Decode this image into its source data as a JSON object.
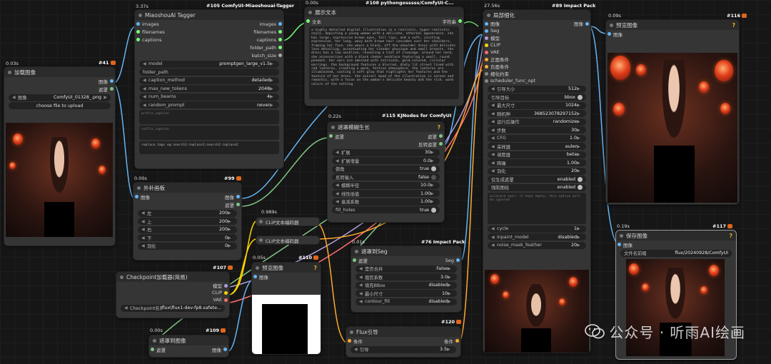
{
  "nodes": {
    "load_image": {
      "time": "0.03s",
      "id": "#41",
      "title": "加载图像",
      "out1": "图像",
      "out2": "遮罩",
      "image_label": "图像",
      "image_value": "ComfyUI_01328_.png",
      "upload": "choose file to upload"
    },
    "tagger": {
      "time": "3.37s",
      "id": "#105 ComfyUI-Miaoshouai-Tagger",
      "title": "MiaoshouAI Tagger",
      "inputs": [
        "images",
        "filenames",
        "captions"
      ],
      "outputs": [
        "images",
        "filenames",
        "captions",
        "folder_path",
        "batch_size"
      ],
      "widgets": [
        {
          "label": "model",
          "value": "promptgen_large_v1.5"
        },
        {
          "label": "folder_path",
          "value": ""
        },
        {
          "label": "caption_method",
          "value": "detailed"
        },
        {
          "label": "max_new_tokens",
          "value": "2048"
        },
        {
          "label": "num_beams",
          "value": "4"
        },
        {
          "label": "random_prompt",
          "value": "never"
        }
      ],
      "prefix": "prefix_caption",
      "suffix": "suffix_caption",
      "replace": "replace_tags eg:search1:replace1;search2:replace2"
    },
    "show_text": {
      "time": "0.00s",
      "id": "#108 pythongosssss/ComfyUI-C...",
      "title": "展示文本",
      "in": "文本",
      "out": "字符串",
      "text": "a highly detailed digital illustration in a realistic, hyper-realistic style, depicting a young woman with a delicate, ethereal appearance. she has large, expressive brown eyes, full lips, and a soft, inviting expression. her long, wavy dark brown hair cascades over her shoulders, framing her face. she wears a black, off-the-shoulder dress with delicate lace detailing, accentuating her slender physique and small breasts. the dress has a low neckline, revealing a hint of cleavage. around her neck, she accessorizes with a black choker necklace featuring a small, round pendant. her ears are adorned with intricate, gold-colored, circular earrings. the background features a blurred, dimly lit street lined with red lanterns, creating a warm, festive atmosphere. the lanterns are illuminated, casting a soft glow that highlights her features and the texture of her dress. the overall mood of the illustration is serene and romantic, with a focus on the woman's delicate beauty and the rich, warm colors of the setting"
    },
    "outpaint": {
      "time": "0.00s",
      "id": "#99",
      "title": "外补画板",
      "in": "图像",
      "out1": "图像",
      "out2": "遮罩",
      "widgets": [
        {
          "label": "左",
          "value": "200"
        },
        {
          "label": "上",
          "value": "200"
        },
        {
          "label": "右",
          "value": "200"
        },
        {
          "label": "下",
          "value": "0"
        },
        {
          "label": "羽化",
          "value": "0"
        }
      ]
    },
    "grow_mask": {
      "time": "0.22s",
      "id": "#115 KJNodes for ComfyUI",
      "title": "遮罩模糊生长",
      "in": "遮罩",
      "out1": "遮罩",
      "out2": "反转遮罩",
      "widgets": [
        {
          "label": "扩展",
          "value": "30"
        },
        {
          "label": "扩展增量",
          "value": "0.0"
        },
        {
          "label": "倒角",
          "value": "true",
          "toggle": true
        },
        {
          "label": "反转输入",
          "value": "false"
        },
        {
          "label": "模糊半径",
          "value": "10.0"
        },
        {
          "label": "线性插值",
          "value": "1.00"
        },
        {
          "label": "衰减系数",
          "value": "1.00"
        },
        {
          "label": "fill_holes",
          "value": "true",
          "toggle": true
        }
      ]
    },
    "clip_enc1": {
      "time": "0.989s",
      "title": "CLIP文本编码器"
    },
    "clip_enc2": {
      "title": "CLIP文本编码器"
    },
    "mask_to_seg": {
      "time": "0.01s",
      "id": "#76 Impact Pack",
      "title": "遮罩到Seg",
      "in": "遮罩",
      "out": "Seg",
      "widgets": [
        {
          "label": "是否合并",
          "value": "False"
        },
        {
          "label": "裁剪系数",
          "value": "3.0"
        },
        {
          "label": "填充BBox",
          "value": "disabled"
        },
        {
          "label": "最小尺寸",
          "value": "10"
        },
        {
          "label": "contour_fill",
          "value": "disabled"
        }
      ]
    },
    "checkpoint": {
      "id": "#107",
      "title": "Checkpoint加载器(简易)",
      "outputs": [
        "模型",
        "CLIP",
        "VAE"
      ],
      "ckpt_label": "Checkpoint名称",
      "ckpt_value": "flux\\flux1-dev-fp8.safete..."
    },
    "preview_mask": {
      "time": "0.05s",
      "id": "#110",
      "title": "预览图像",
      "in": "图像"
    },
    "mask_to_image": {
      "time": "0.00s",
      "id": "#109",
      "title": "遮罩到图像",
      "in": "遮罩",
      "out": "图像"
    },
    "flux_guide": {
      "id": "#120",
      "title": "Flux引导",
      "in": "条件",
      "out": "条件",
      "label": "引导",
      "value": "3.5"
    },
    "detailer": {
      "time": "27.56s",
      "id": "#89 Impact Pack",
      "title": "局部细化",
      "out": "图像",
      "inputs": [
        "图像",
        "Seg",
        "模型",
        "CLIP",
        "VAE",
        "正面条件",
        "负面条件",
        "细化约束",
        "scheduler_func_opt"
      ],
      "widgets": [
        {
          "label": "引导大小",
          "value": "512"
        },
        {
          "label": "引导目标",
          "value": "bbox",
          "toggle": true
        },
        {
          "label": "最大尺寸",
          "value": "1024"
        },
        {
          "label": "随机种",
          "value": "368523078297152"
        },
        {
          "label": "运行后操作",
          "value": "randomize"
        },
        {
          "label": "步数",
          "value": "30"
        },
        {
          "label": "CFG",
          "value": "1.0"
        },
        {
          "label": "采样器",
          "value": "euler"
        },
        {
          "label": "调度器",
          "value": "beta"
        },
        {
          "label": "降噪",
          "value": "1.00"
        },
        {
          "label": "羽化",
          "value": "20"
        },
        {
          "label": "仅生成遮罩",
          "value": "enabled",
          "toggle": true
        },
        {
          "label": "强制图绘",
          "value": "enabled",
          "toggle": true
        }
      ],
      "wildcard": "wildcard spec: if kept empty, this option will be ignored",
      "widgets2": [
        {
          "label": "cycle",
          "value": "1"
        },
        {
          "label": "inpaint_model",
          "value": "disabled"
        },
        {
          "label": "noise_mask_feather",
          "value": "20"
        }
      ]
    },
    "preview_top": {
      "time": "0.09s",
      "id": "#116",
      "title": "预览图像",
      "in": "图像"
    },
    "save_image": {
      "time": "0.19s",
      "id": "#117",
      "title": "保存图像",
      "in": "图像",
      "prefix_label": "文件名前缀",
      "prefix_value": "flux/20240928/ComfyUI"
    }
  },
  "watermark": "公众号 · 听雨AI绘画",
  "colors": {
    "image": "#64b5f6",
    "mask": "#81c784",
    "conditioning": "#ffa931",
    "clip": "#ffd500",
    "model": "#b39ddb",
    "vae": "#ff6e6e",
    "string": "#77ff77"
  }
}
